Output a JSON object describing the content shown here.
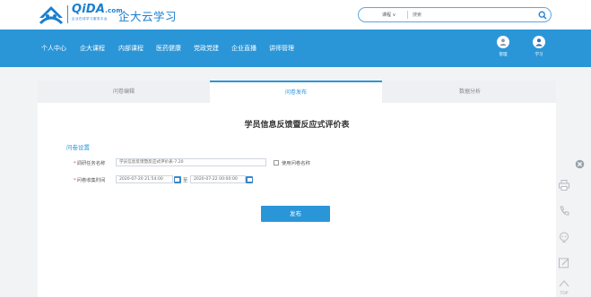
{
  "header": {
    "logo_brand": "QiDA",
    "logo_brand_suffix": ".com",
    "logo_tagline": "企业在线学习服务平台",
    "logo_cn": "企大云学习",
    "search": {
      "category": "课程",
      "placeholder": "搜索"
    }
  },
  "nav": {
    "items": [
      "个人中心",
      "企大课程",
      "内部课程",
      "医药健康",
      "党政党建",
      "企业直播",
      "讲师管理"
    ],
    "tools": [
      {
        "label": "管理",
        "icon": "manage-icon"
      },
      {
        "label": "学习",
        "icon": "user-icon"
      }
    ],
    "colors": {
      "bar": "#2a96d8"
    }
  },
  "tabs": [
    {
      "label": "问卷编辑",
      "active": false
    },
    {
      "label": "问卷发布",
      "active": true
    },
    {
      "label": "数据分析",
      "active": false
    }
  ],
  "form": {
    "title": "学员信息反馈暨反应式评价表",
    "section_label": "问卷设置",
    "task_name_label": "调研任务名称",
    "task_name_value": "学员信息反馈暨反应式评价表-7.20",
    "use_name_label": "使用问卷名称",
    "time_label": "问卷收集时间",
    "start_time": "2020-07-20 21:54:00",
    "to_label": "至",
    "end_time": "2020-07-22 00:00:00",
    "publish_label": "发布"
  },
  "side_toolbar": {
    "buttons": [
      "print-icon",
      "phone-icon",
      "chat-icon",
      "edit-icon",
      "top-icon"
    ],
    "top_label": "TOP"
  }
}
